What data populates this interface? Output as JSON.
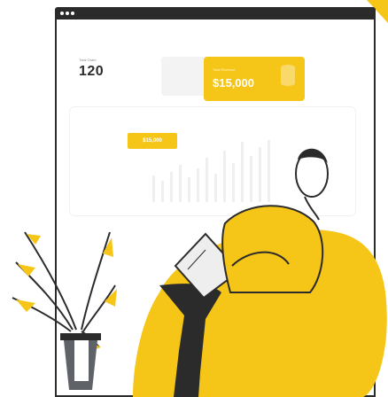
{
  "stats": {
    "total_order_label": "Total Order",
    "total_order_value": "120",
    "total_revenue_label": "Total Revenue",
    "total_revenue_value": "$15,000"
  },
  "chart": {
    "tooltip_value": "$15,000"
  },
  "colors": {
    "accent": "#f5c518",
    "dark": "#2b2b2b",
    "window_frame": "#2b2b2b",
    "plant_pot": "#5f6368"
  },
  "icons": {
    "window_controls": "traffic-light-dots",
    "revenue_card_decoration": "coin-stack-icon"
  }
}
